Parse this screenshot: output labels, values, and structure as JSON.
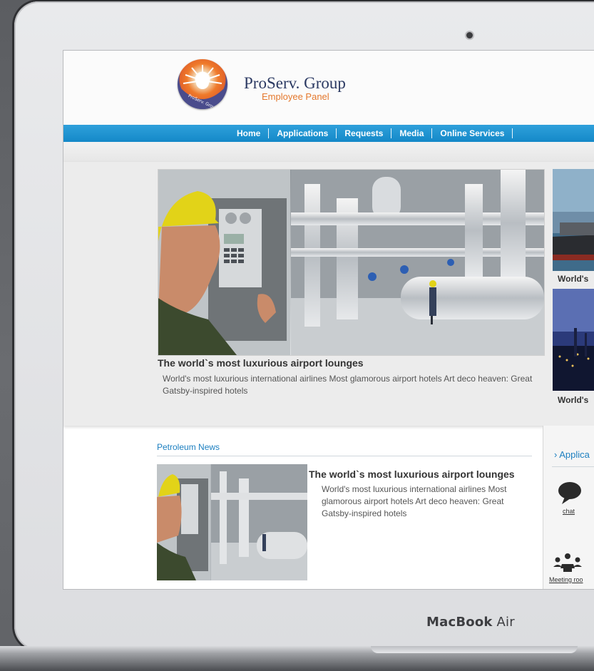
{
  "device": {
    "brand_bold": "MacBook",
    "brand_light": " Air"
  },
  "site": {
    "title": "ProServ. Group",
    "subtitle": "Employee Panel",
    "logo_ring_text": "ProServ. Group",
    "colors": {
      "nav": "#1489c8",
      "accent": "#e4782d",
      "title": "#2c3a63"
    }
  },
  "nav": {
    "items": [
      "Home",
      "Applications",
      "Requests",
      "Media",
      "Online Services"
    ]
  },
  "feature": {
    "caption": "The world`s most luxurious airport lounges",
    "description": "World's most luxurious international airlines Most glamorous airport hotels Art deco heaven: Great Gatsby-inspired hotels",
    "side_items": [
      {
        "caption": "World's"
      },
      {
        "caption": "World's"
      }
    ]
  },
  "news": {
    "section_title": "Petroleum News",
    "headline": "The world`s most luxurious airport lounges",
    "description": "World's most luxurious international airlines Most glamorous airport hotels Art deco heaven: Great Gatsby-inspired hotels"
  },
  "apps": {
    "title": "› Applica",
    "items": [
      {
        "label": "chat",
        "icon": "chat-bubble-icon"
      },
      {
        "label": "Meeting roo",
        "icon": "meeting-room-icon"
      }
    ]
  }
}
